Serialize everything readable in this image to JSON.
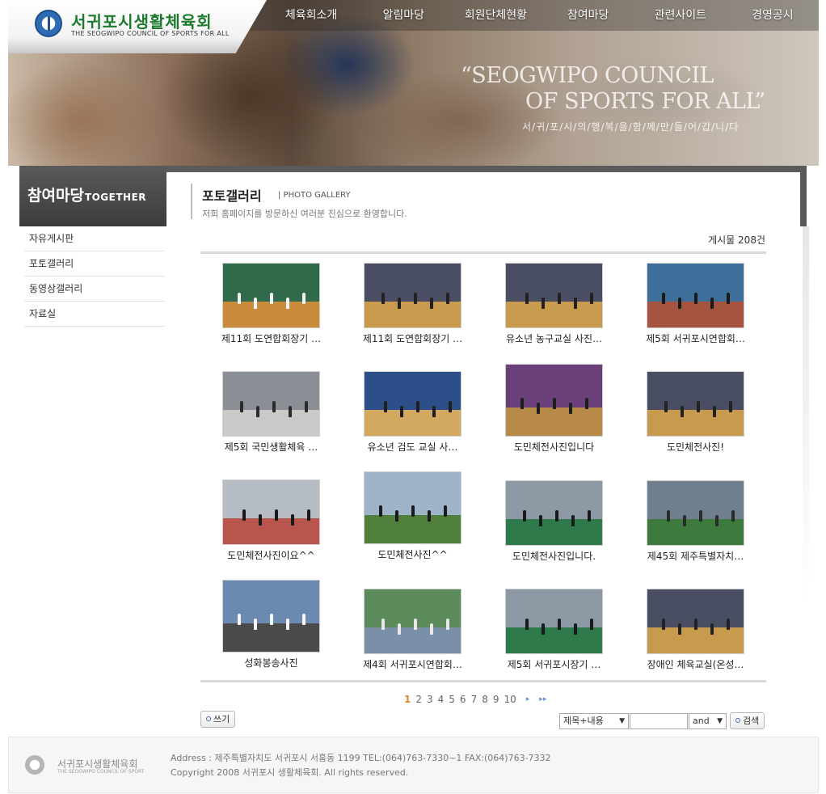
{
  "header": {
    "logo_title": "서귀포시생활체육회",
    "logo_subtitle": "THE SEOGWIPO COUNCIL OF SPORTS FOR ALL",
    "nav": [
      "체육회소개",
      "알림마당",
      "회원단체현황",
      "참여마당",
      "관련사이트",
      "경영공시"
    ],
    "slogan_line1": "“SEOGWIPO COUNCIL",
    "slogan_line2": "OF SPORTS FOR ALL”",
    "slogan_korean": "서/귀/포/시/의/행/복/을/함/께/만/들/어/갑/니/다"
  },
  "sidebar": {
    "title": "참여마당",
    "title_en": "TOGETHER",
    "items": [
      "자유게시판",
      "포토갤러리",
      "동영상갤러리",
      "자료실"
    ]
  },
  "page": {
    "title": "포토갤러리",
    "title_en": "| PHOTO GALLERY",
    "welcome": "저희 홈페이지를 방문하신 여러분 진심으로 환영합니다.",
    "post_count": "게시물 208건"
  },
  "gallery": [
    {
      "caption": "제11회 도연합회장기 …",
      "theme": "gym-green"
    },
    {
      "caption": "제11회 도연합회장기 …",
      "theme": "gym-wood"
    },
    {
      "caption": "유소년 농구교실 사진…",
      "theme": "gym-wood"
    },
    {
      "caption": "제5회 서귀포시연합회…",
      "theme": "stage"
    },
    {
      "caption": "제5회 국민생활체육 …",
      "theme": "banner"
    },
    {
      "caption": "유소년 검도 교실 사…",
      "theme": "gym-blue"
    },
    {
      "caption": "도민체전사진입니다",
      "theme": "gym-colorful"
    },
    {
      "caption": "도민체전사진!",
      "theme": "gym-wood"
    },
    {
      "caption": "도민체전사진이요^^",
      "theme": "court-red"
    },
    {
      "caption": "도민체전사진^^",
      "theme": "field"
    },
    {
      "caption": "도민체전사진입니다.",
      "theme": "turf"
    },
    {
      "caption": "제45회 제주특별자치…",
      "theme": "banner-crowd"
    },
    {
      "caption": "성화봉송사진",
      "theme": "street"
    },
    {
      "caption": "제4회 서귀포시연합회…",
      "theme": "crowd"
    },
    {
      "caption": "제5회 서귀포시장기 …",
      "theme": "turf"
    },
    {
      "caption": "장애인 체육교실(온성…",
      "theme": "gym-wood"
    }
  ],
  "pagination": {
    "pages": [
      "1",
      "2",
      "3",
      "4",
      "5",
      "6",
      "7",
      "8",
      "9",
      "10"
    ],
    "current": "1",
    "next": "▸",
    "last": "▸▸"
  },
  "actions": {
    "write_label": "쓰기",
    "search_field_option": "제목+내용",
    "search_placeholder": "",
    "search_operator": "and",
    "search_label": "검색"
  },
  "footer": {
    "logo": "서귀포시생활체육회",
    "logo_sub": "THE SEOGWIPO COUNCIL OF SPORT",
    "address": "Address : 제주특별자치도 서귀포시 서홍동 1199    TEL:(064)763-7330~1    FAX:(064)763-7332",
    "copyright": "Copyright 2008 서귀포시 생활체육회. All rights reserved."
  },
  "colors": {
    "accent_orange": "#e0862b",
    "logo_green": "#1c7a2f",
    "sidebar_dark": "#4a4a4a"
  }
}
